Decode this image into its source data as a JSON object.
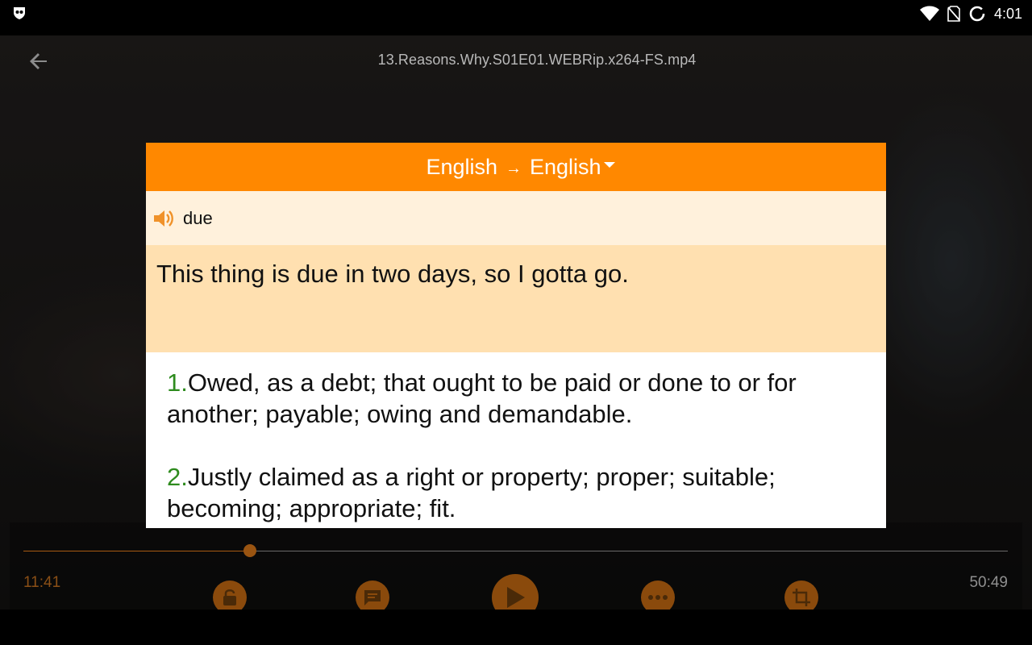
{
  "status_bar": {
    "time": "4:01"
  },
  "player": {
    "file_title": "13.Reasons.Why.S01E01.WEBRip.x264-FS.mp4",
    "current_time": "11:41",
    "total_time": "50:49",
    "progress": 0.23,
    "accent_color": "#ff8800"
  },
  "dictionary": {
    "source_lang": "English",
    "arrow": "→",
    "target_lang": "English",
    "word": "due",
    "sentence": "This thing is due in two days, so I gotta go.",
    "definitions": [
      {
        "num": "1.",
        "text": "Owed, as a debt; that ought to be paid or done to or for another; payable; owing and demandable."
      },
      {
        "num": "2.",
        "text": "Justly claimed as a right or property; proper; suitable; becoming; appropriate; fit."
      }
    ],
    "number_color": "#2e8b1e",
    "header_color": "#ff8800"
  },
  "icons": {
    "status_left": "app-shield-icon",
    "wifi": "wifi-icon",
    "no_sim": "no-sim-icon",
    "sync": "sync-icon",
    "back": "back-arrow-icon",
    "speaker": "speaker-icon",
    "dropdown": "dropdown-caret-icon",
    "lock": "lock-icon",
    "subtitles": "subtitles-icon",
    "play": "play-icon",
    "more": "more-icon",
    "crop": "crop-icon"
  }
}
